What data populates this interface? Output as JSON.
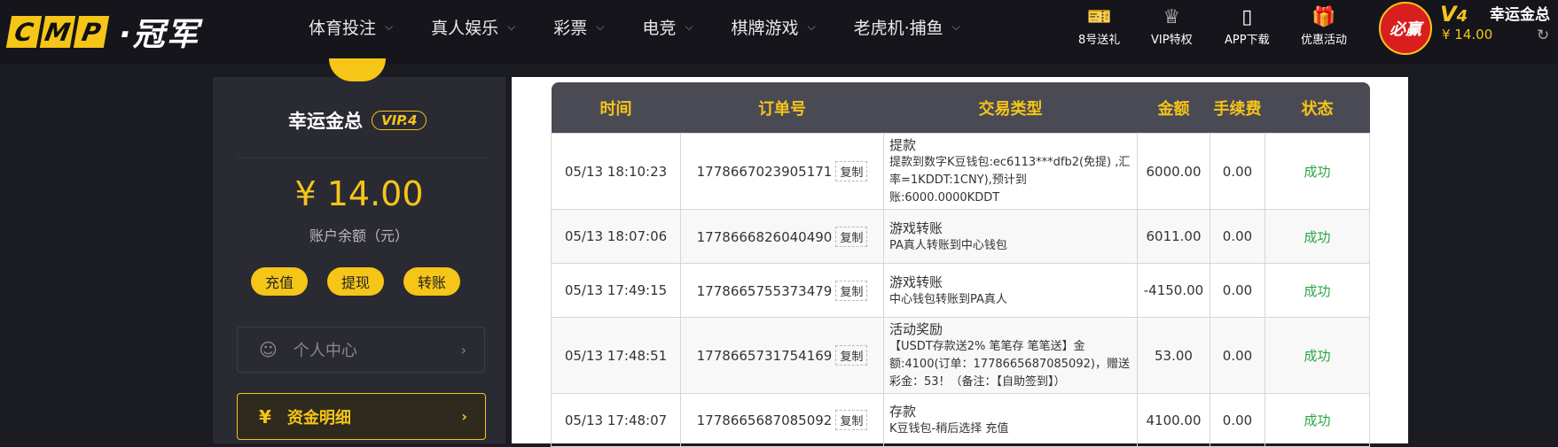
{
  "header": {
    "logo_letters": [
      "C",
      "M",
      "P"
    ],
    "logo_text": "·冠军",
    "nav": [
      {
        "label": "体育投注"
      },
      {
        "label": "真人娱乐"
      },
      {
        "label": "彩票"
      },
      {
        "label": "电竞"
      },
      {
        "label": "棋牌游戏"
      },
      {
        "label": "老虎机·捕鱼"
      }
    ],
    "quick_links": [
      {
        "label": "8号送礼",
        "icon": "ticket-icon"
      },
      {
        "label": "VIP特权",
        "icon": "crown-icon"
      },
      {
        "label": "APP下载",
        "icon": "phone-icon"
      },
      {
        "label": "优惠活动",
        "icon": "gift-icon"
      }
    ],
    "avatar_text": "必赢",
    "vip_level": "V",
    "vip_level_num": "4",
    "balance": "¥ 14.00",
    "username": "幸运金总"
  },
  "sidebar": {
    "username": "幸运金总",
    "vip_badge": "VIP.4",
    "balance": "¥ 14.00",
    "balance_label": "账户余额（元）",
    "actions": [
      "充值",
      "提现",
      "转账"
    ],
    "menu_personal": "个人中心",
    "menu_funds": "资金明细"
  },
  "table": {
    "headers": [
      "时间",
      "订单号",
      "交易类型",
      "金额",
      "手续费",
      "状态"
    ],
    "copy_label": "复制",
    "rows": [
      {
        "time": "05/13 18:10:23",
        "order": "1778667023905171",
        "type": "提款",
        "desc": "提款到数字K豆钱包:ec6113***dfb2(免提) ,汇率=1KDDT:1CNY),预计到账:6000.0000KDDT",
        "amount": "6000.00",
        "fee": "0.00",
        "status": "成功"
      },
      {
        "time": "05/13 18:07:06",
        "order": "1778666826040490",
        "type": "游戏转账",
        "desc": "PA真人转账到中心钱包",
        "amount": "6011.00",
        "fee": "0.00",
        "status": "成功"
      },
      {
        "time": "05/13 17:49:15",
        "order": "1778665755373479",
        "type": "游戏转账",
        "desc": "中心钱包转账到PA真人",
        "amount": "-4150.00",
        "fee": "0.00",
        "status": "成功"
      },
      {
        "time": "05/13 17:48:51",
        "order": "1778665731754169",
        "type": "活动奖励",
        "desc": "【USDT存款送2% 笔笔存 笔笔送】金额:4100(订单：1778665687085092)，赠送彩金：53！（备注：【自助签到】）",
        "amount": "53.00",
        "fee": "0.00",
        "status": "成功"
      },
      {
        "time": "05/13 17:48:07",
        "order": "1778665687085092",
        "type": "存款",
        "desc": "K豆钱包-稍后选择 充值",
        "amount": "4100.00",
        "fee": "0.00",
        "status": "成功"
      }
    ]
  },
  "colors": {
    "accent": "#f5c518",
    "success": "#28a745",
    "header_bg": "#15151b"
  }
}
